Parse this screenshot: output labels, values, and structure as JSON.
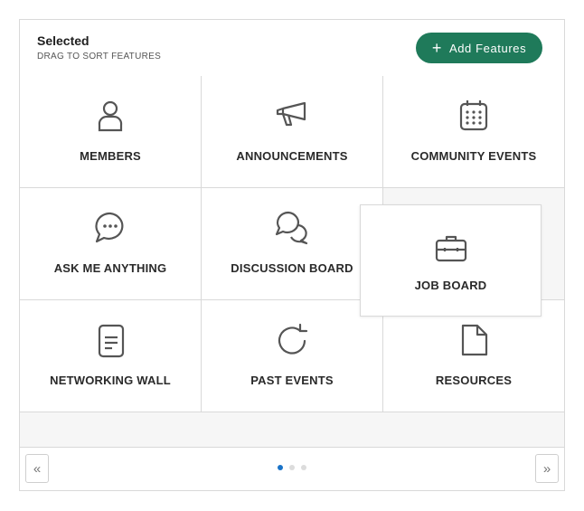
{
  "header": {
    "title": "Selected",
    "subtitle": "DRAG TO SORT FEATURES",
    "add_button_label": "Add Features",
    "add_button_icon": "plus-icon",
    "accent_color": "#1f7a5a"
  },
  "features": [
    {
      "label": "MEMBERS",
      "icon": "person-icon"
    },
    {
      "label": "ANNOUNCEMENTS",
      "icon": "megaphone-icon"
    },
    {
      "label": "COMMUNITY EVENTS",
      "icon": "calendar-icon"
    },
    {
      "label": "ASK ME ANYTHING",
      "icon": "chat-bubble-icon"
    },
    {
      "label": "DISCUSSION BOARD",
      "icon": "discussion-bubbles-icon"
    },
    {
      "label": "NETWORKING WALL",
      "icon": "document-icon"
    },
    {
      "label": "PAST EVENTS",
      "icon": "refresh-icon"
    },
    {
      "label": "RESOURCES",
      "icon": "file-icon"
    }
  ],
  "dragging": {
    "label": "JOB BOARD",
    "icon": "briefcase-icon"
  },
  "pagination": {
    "prev_label": "«",
    "next_label": "»",
    "pages": 3,
    "active_page": 1,
    "active_color": "#1a73c8"
  }
}
